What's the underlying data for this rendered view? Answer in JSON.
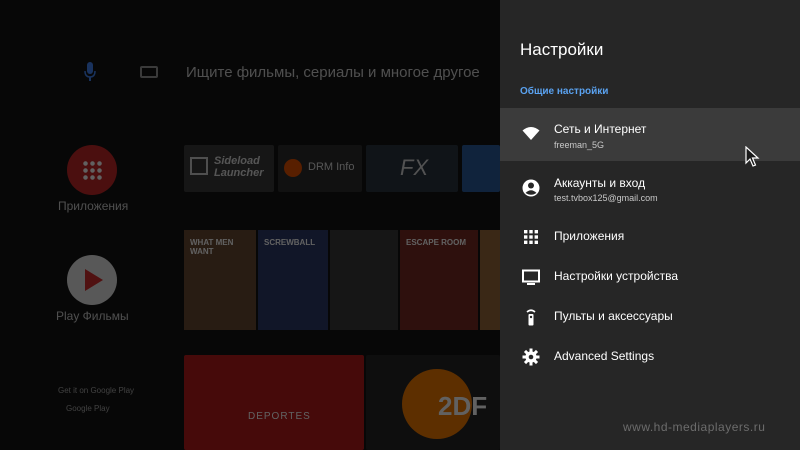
{
  "launcher": {
    "search_hint": "Ищите фильмы, сериалы и многое другое",
    "apps_label": "Приложения",
    "play_movies_label": "Play Фильмы",
    "tiles": {
      "sideload": "Sideload Launcher",
      "drm": "DRM Info",
      "fx": "FX",
      "deportes": "DEPORTES",
      "zdf": "2DF"
    },
    "posters": [
      "WHAT MEN WANT",
      "SCREWBALL",
      "",
      "ESCAPE ROOM",
      ""
    ],
    "footer_line": "Get it on Google Play",
    "google_play": "Google Play"
  },
  "settings": {
    "title": "Настройки",
    "section_header": "Общие настройки",
    "items": [
      {
        "icon": "wifi-icon",
        "label": "Сеть и Интернет",
        "sub": "freeman_5G",
        "selected": true
      },
      {
        "icon": "account-icon",
        "label": "Аккаунты и вход",
        "sub": "test.tvbox125@gmail.com"
      },
      {
        "icon": "apps-grid-icon",
        "label": "Приложения"
      },
      {
        "icon": "tv-icon",
        "label": "Настройки устройства"
      },
      {
        "icon": "remote-icon",
        "label": "Пульты и аксессуары"
      },
      {
        "icon": "gear-icon",
        "label": "Advanced Settings"
      }
    ]
  },
  "watermark": "www.hd-mediaplayers.ru",
  "colors": {
    "panel_bg": "#262626",
    "selected_bg": "#3b3b3b",
    "section_accent": "#5aa2f0"
  }
}
